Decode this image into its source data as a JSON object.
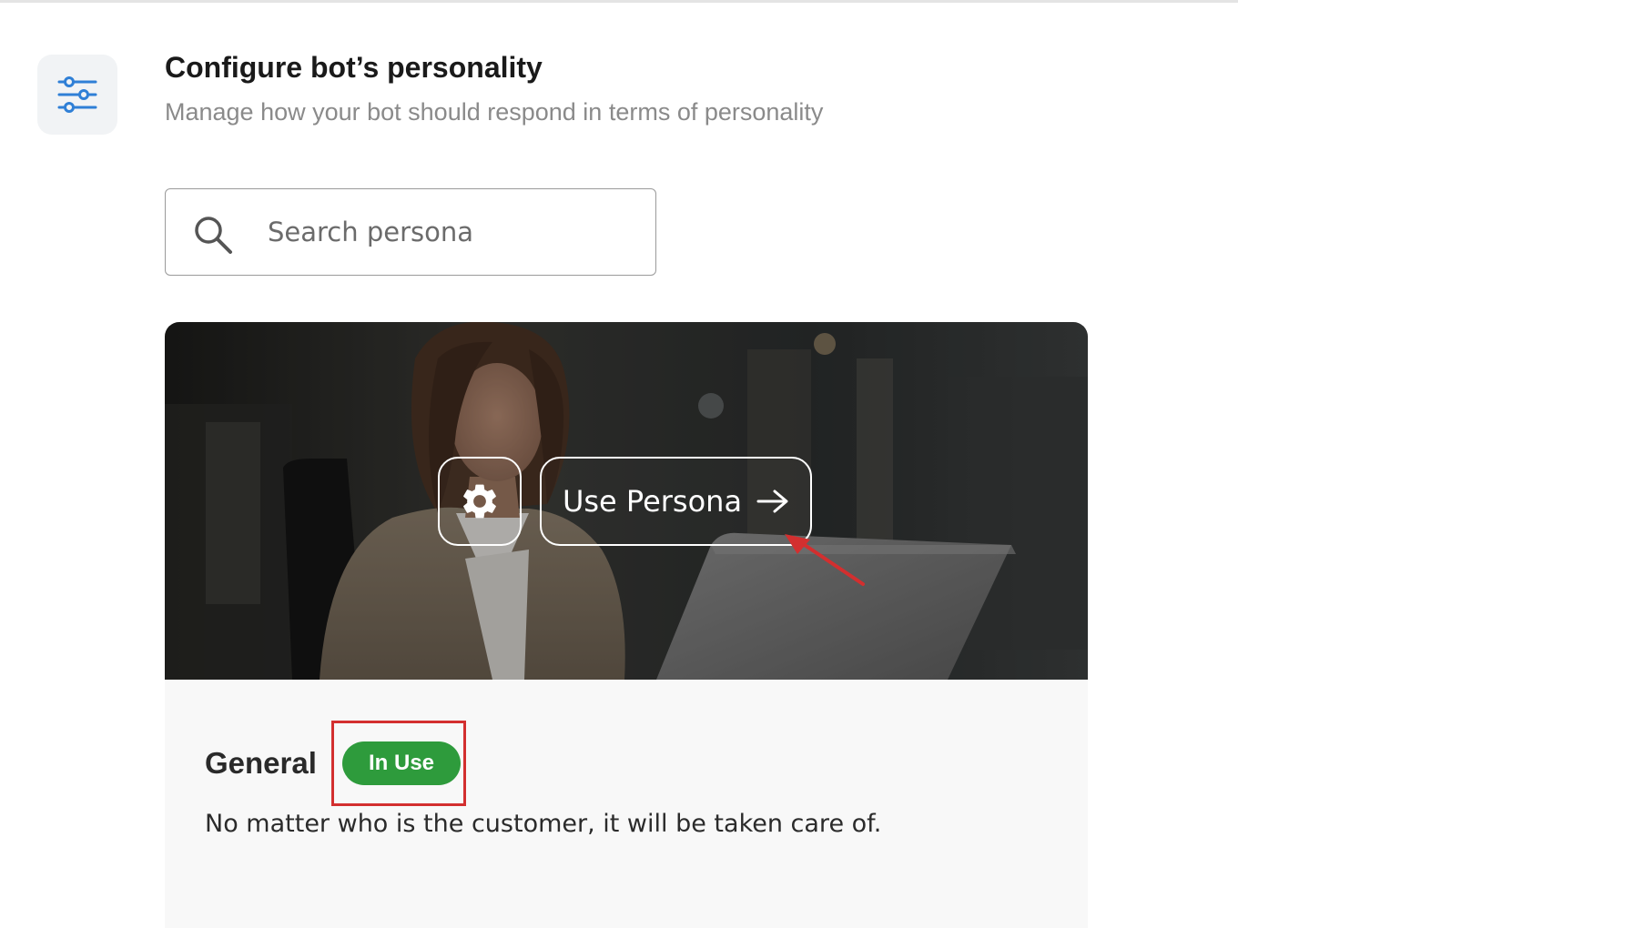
{
  "header": {
    "title": "Configure bot’s personality",
    "subtitle": "Manage how your bot should respond in terms of personality",
    "icon": "sliders-icon"
  },
  "search": {
    "placeholder": "Search persona",
    "value": "",
    "icon": "search-icon"
  },
  "persona_card": {
    "image": "woman-at-laptop-photo",
    "settings_icon": "gear-icon",
    "use_button_label": "Use Persona",
    "use_button_icon": "arrow-right-icon",
    "name": "General",
    "status_badge": "In Use",
    "description": "No matter who is the customer, it will be taken care of."
  },
  "colors": {
    "accent": "#2f7fd6",
    "badge_green": "#2e9b3c",
    "highlight_red": "#d32f2f"
  }
}
